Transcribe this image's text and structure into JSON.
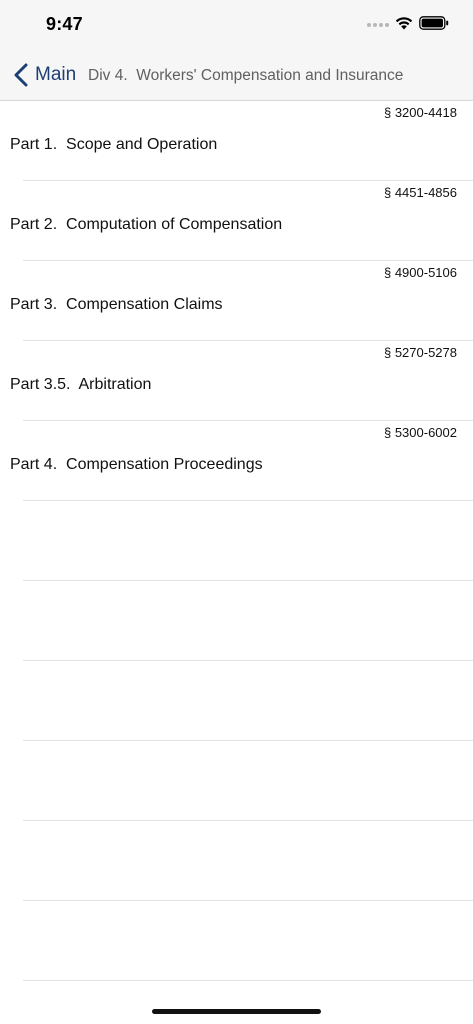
{
  "status_bar": {
    "time": "9:47"
  },
  "nav": {
    "back_label": "Main",
    "title": "Div 4.  Workers' Compensation and Insurance"
  },
  "rows": [
    {
      "range": "§ 3200-4418",
      "title": "Part 1.  Scope and Operation"
    },
    {
      "range": "§ 4451-4856",
      "title": "Part 2.  Computation of Compensation"
    },
    {
      "range": "§ 4900-5106",
      "title": "Part 3.  Compensation Claims"
    },
    {
      "range": "§ 5270-5278",
      "title": "Part 3.5.  Arbitration"
    },
    {
      "range": "§ 5300-6002",
      "title": "Part 4.  Compensation Proceedings"
    }
  ],
  "colors": {
    "accent": "#1d3f73",
    "bar_background": "#f6f6f6",
    "divider": "#e2e2e2"
  },
  "icons": [
    "chevron-left-icon",
    "signal-dots-icon",
    "wifi-icon",
    "battery-icon"
  ]
}
